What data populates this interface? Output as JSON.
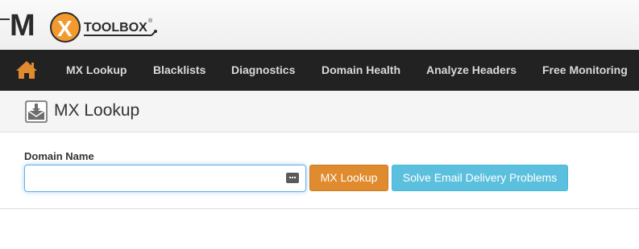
{
  "brand": {
    "logo_text": "TOOLBOX",
    "logo_letter_m": "M",
    "logo_letter_x": "X",
    "accent_color": "#f29a2e"
  },
  "nav": {
    "home_icon": "home-icon",
    "items": [
      {
        "label": "MX Lookup"
      },
      {
        "label": "Blacklists"
      },
      {
        "label": "Diagnostics"
      },
      {
        "label": "Domain Health"
      },
      {
        "label": "Analyze Headers"
      },
      {
        "label": "Free Monitoring"
      }
    ]
  },
  "page": {
    "title": "MX Lookup",
    "title_icon": "envelope-download-icon"
  },
  "form": {
    "label": "Domain Name",
    "input_value": "",
    "input_placeholder": "",
    "lookup_button": "MX Lookup",
    "solve_button": "Solve Email Delivery Problems"
  },
  "colors": {
    "navbar_bg": "#222222",
    "nav_text": "#d9d9d9",
    "mx_button": "#e08b2e",
    "solve_button": "#5bc0de",
    "input_focus": "#66afe9"
  }
}
